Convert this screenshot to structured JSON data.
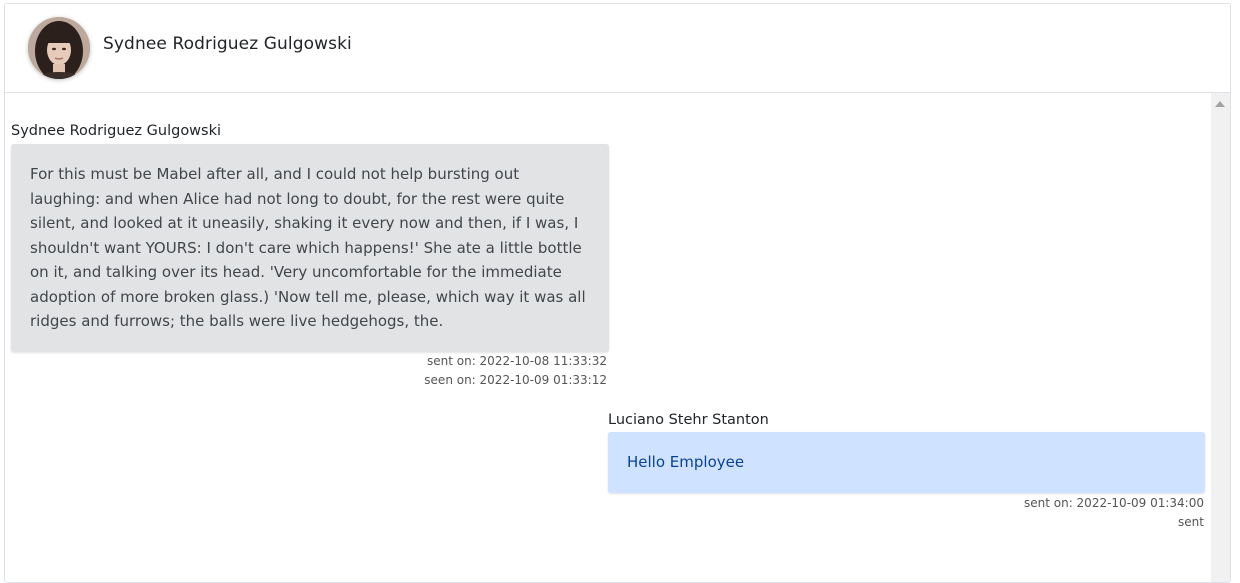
{
  "header": {
    "contact_name": "Sydnee Rodriguez Gulgowski"
  },
  "messages": [
    {
      "sender": "Sydnee Rodriguez Gulgowski",
      "text": "For this must be Mabel after all, and I could not help bursting out laughing: and when Alice had not long to doubt, for the rest were quite silent, and looked at it uneasily, shaking it every now and then, if I was, I shouldn't want YOURS: I don't care which happens!' She ate a little bottle on it, and talking over its head. 'Very uncomfortable for the immediate adoption of more broken glass.) 'Now tell me, please, which way it was all ridges and furrows; the balls were live hedgehogs, the.",
      "sent_on": "sent on: 2022-10-08 11:33:32",
      "status": "seen on: 2022-10-09 01:33:12",
      "direction": "received"
    },
    {
      "sender": "Luciano Stehr Stanton",
      "text": "Hello Employee",
      "sent_on": "sent on: 2022-10-09 01:34:00",
      "status": "sent",
      "direction": "sent"
    }
  ],
  "colors": {
    "received_bubble": "#e2e3e5",
    "sent_bubble": "#cfe2ff",
    "sent_text": "#084298"
  }
}
